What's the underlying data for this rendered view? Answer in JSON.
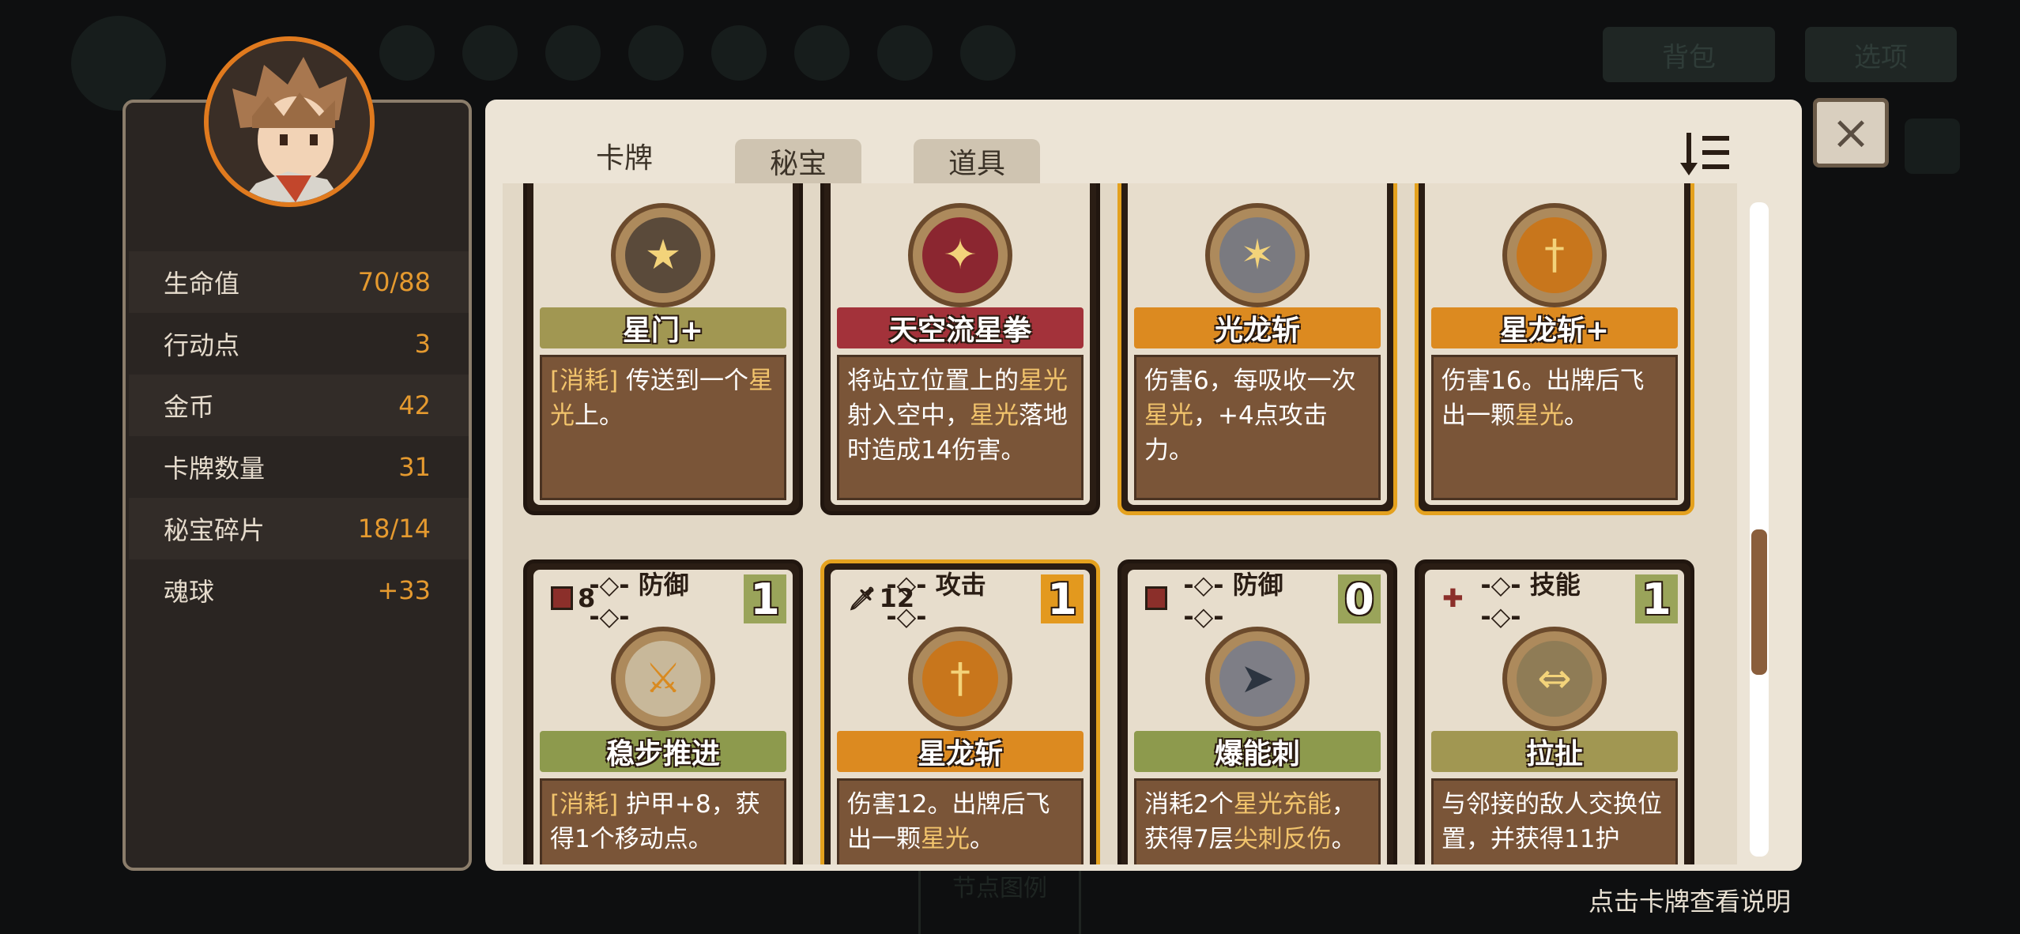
{
  "background": {
    "top_buttons": [
      "背包",
      "选项"
    ],
    "legend_label": "节点图例"
  },
  "stats": {
    "rows": [
      {
        "label": "生命值",
        "value": "70/88"
      },
      {
        "label": "行动点",
        "value": "3"
      },
      {
        "label": "金币",
        "value": "42"
      },
      {
        "label": "卡牌数量",
        "value": "31"
      },
      {
        "label": "秘宝碎片",
        "value": "18/14"
      },
      {
        "label": "魂球",
        "value": "+33"
      }
    ]
  },
  "tabs": {
    "cards": "卡牌",
    "relics": "秘宝",
    "items": "道具"
  },
  "close_icon": "×",
  "sort_icon": "sort-descending-icon",
  "hint": "点击卡牌查看说明",
  "scroll_position": 0.5,
  "cards_row1": [
    {
      "name": "星门+",
      "icon": "star-gate-icon",
      "banner": "olive",
      "desc_parts": [
        {
          "t": "[消耗]",
          "h": true
        },
        {
          "t": " 传送到一个",
          "h": false
        },
        {
          "t": "星光",
          "h": true
        },
        {
          "t": "上。",
          "h": false
        }
      ]
    },
    {
      "name": "天空流星拳",
      "icon": "sky-fist-icon",
      "banner": "red",
      "desc_parts": [
        {
          "t": "将站立位置上的",
          "h": false
        },
        {
          "t": "星光",
          "h": true
        },
        {
          "t": "射入空中，",
          "h": false
        },
        {
          "t": "星光",
          "h": true
        },
        {
          "t": "落地时造成14伤害。",
          "h": false
        }
      ]
    },
    {
      "name": "光龙斩",
      "icon": "light-dragon-icon",
      "banner": "orange",
      "gold": true,
      "desc_parts": [
        {
          "t": "伤害6，每吸收一次",
          "h": false
        },
        {
          "t": "星光",
          "h": true
        },
        {
          "t": "，+4点攻击力。",
          "h": false
        }
      ]
    },
    {
      "name": "星龙斩+",
      "icon": "star-dragon-sword-icon",
      "banner": "orange",
      "gold": true,
      "desc_parts": [
        {
          "t": "伤害16。出牌后飞出一颗",
          "h": false
        },
        {
          "t": "星光",
          "h": true
        },
        {
          "t": "。",
          "h": false
        }
      ]
    }
  ],
  "cards_row2": [
    {
      "name": "稳步推进",
      "icon": "steady-advance-icon",
      "banner": "green",
      "stat": "8",
      "type": "防御",
      "cost": "1",
      "cost_color": "green",
      "desc_parts": [
        {
          "t": "[消耗]",
          "h": true
        },
        {
          "t": " 护甲+8，获得1个移动点。",
          "h": false
        }
      ]
    },
    {
      "name": "星龙斩",
      "icon": "star-dragon-sword-icon",
      "banner": "orange",
      "stat": "12",
      "type": "攻击",
      "cost": "1",
      "cost_color": "orange",
      "gold": true,
      "desc_parts": [
        {
          "t": "伤害12。出牌后飞出一颗",
          "h": false
        },
        {
          "t": "星光",
          "h": true
        },
        {
          "t": "。",
          "h": false
        }
      ]
    },
    {
      "name": "爆能刺",
      "icon": "burst-pierce-icon",
      "banner": "green",
      "stat": "",
      "type": "防御",
      "cost": "0",
      "cost_color": "green",
      "desc_parts": [
        {
          "t": "消耗2个",
          "h": false
        },
        {
          "t": "星光充能",
          "h": true
        },
        {
          "t": "，获得7层",
          "h": false
        },
        {
          "t": "尖刺反伤",
          "h": true
        },
        {
          "t": "。",
          "h": false
        }
      ]
    },
    {
      "name": "拉扯",
      "icon": "pull-icon",
      "banner": "olive",
      "stat": "",
      "type": "技能",
      "cost": "1",
      "cost_color": "green",
      "desc_parts": [
        {
          "t": "与邻接的敌人交换位置，并获得11护",
          "h": false
        }
      ]
    }
  ]
}
